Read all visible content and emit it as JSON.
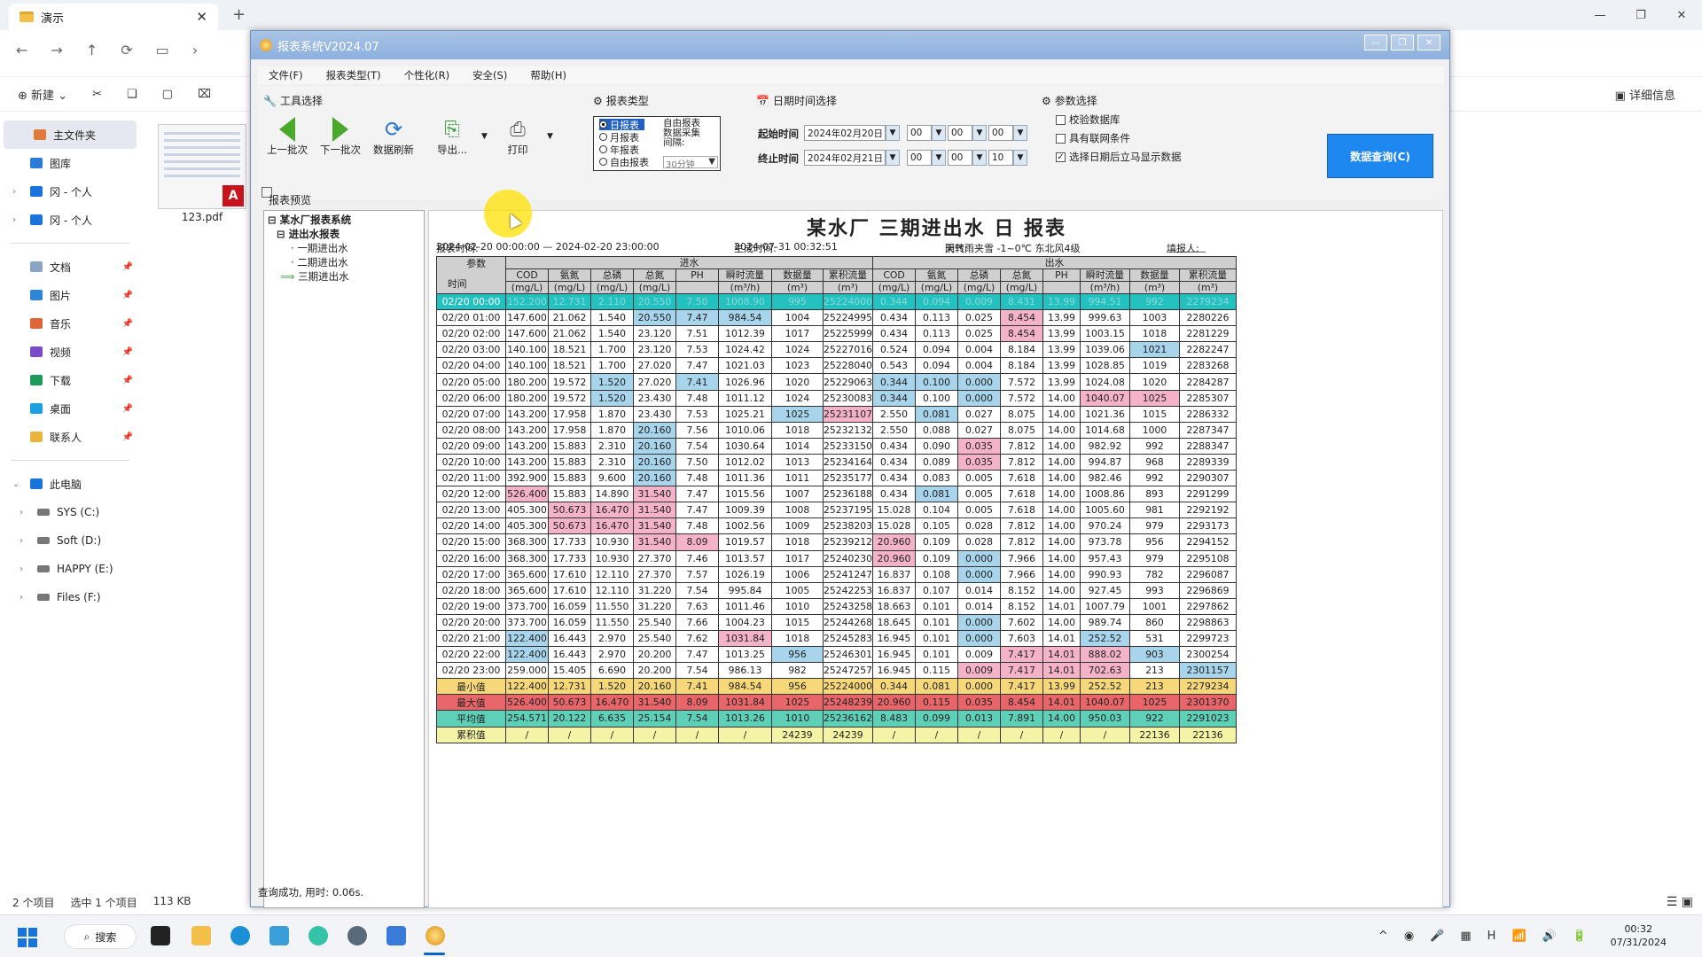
{
  "explorer": {
    "tab_title": "演示",
    "new_tab": "+",
    "nav": [
      "←",
      "→",
      "↑",
      "⟳",
      "▭",
      "›"
    ],
    "cmd": {
      "new": "新建",
      "details": "详细信息"
    },
    "sidebar": {
      "quick": [
        {
          "label": "主文件夹",
          "color": "#e07a3a"
        },
        {
          "label": "图库",
          "color": "#2b7bd6"
        },
        {
          "label": "冈 - 个人",
          "color": "#1a73d9"
        },
        {
          "label": "冈 - 个人",
          "color": "#1a73d9"
        }
      ],
      "pinned": [
        {
          "label": "文档",
          "color": "#8aa4c8"
        },
        {
          "label": "图片",
          "color": "#2d86d8"
        },
        {
          "label": "音乐",
          "color": "#e0633a"
        },
        {
          "label": "视频",
          "color": "#7a4bc8"
        },
        {
          "label": "下载",
          "color": "#1c9b5a"
        },
        {
          "label": "桌面",
          "color": "#1ba1e2"
        },
        {
          "label": "联系人",
          "color": "#e8b43a"
        }
      ],
      "pc": "此电脑",
      "drives": [
        "SYS (C:)",
        "Soft (D:)",
        "HAPPY (E:)",
        "Files (F:)"
      ]
    },
    "file": {
      "name": "123.pdf",
      "badge": "A"
    },
    "status": {
      "count": "2 个项目",
      "selected": "选中 1 个项目",
      "size": "113 KB"
    }
  },
  "app": {
    "title": "报表系统V2024.07",
    "menu": [
      "文件(F)",
      "报表类型(T)",
      "个性化(R)",
      "安全(S)",
      "帮助(H)"
    ],
    "tools": {
      "title": "工具选择",
      "prev": "上一批次",
      "next": "下一批次",
      "refresh": "数据刷新",
      "export": "导出...",
      "print": "打印"
    },
    "rtype": {
      "title": "报表类型",
      "daily": "日报表",
      "monthly": "月报表",
      "yearly": "年报表",
      "custom": "自由报表",
      "custom_right": "自由报表",
      "collect": "数据采集",
      "interval_label": "间隔:",
      "interval": "30分钟"
    },
    "dt": {
      "title": "日期时间选择",
      "start_label": "起始时间",
      "start_date": "2024年02月20日",
      "start_h": "00",
      "start_m": "00",
      "start_s": "00",
      "end_label": "终止时间",
      "end_date": "2024年02月21日",
      "end_h": "00",
      "end_m": "00",
      "end_s": "10"
    },
    "params": {
      "title": "参数选择",
      "check1": "校验数据库",
      "check2": "具有联网条件",
      "check3": "选择日期后立马显示数据"
    },
    "query": "数据查询(C)",
    "preview": "报表预览",
    "tree": {
      "root": "某水厂报表系统",
      "group": "进出水报表",
      "items": [
        "一期进出水",
        "二期进出水",
        "三期进出水"
      ]
    },
    "status": "查询成功, 用时: 0.06s."
  },
  "report": {
    "title": "某水厂 三期进出水 日 报表",
    "time_label": "报表时间:",
    "time_range": "2024-02-20 00:00:00 — 2024-02-20 23:00:00",
    "gen_label": "生成时间:",
    "gen_time": "2024-07-31  00:32:51",
    "weather_label": "天气:",
    "weather": "阴转雨夹雪  -1~0℃  东北风4级",
    "filler_label": "填报人:",
    "filler": "________",
    "header": {
      "param": "参数",
      "time": "时间",
      "in": "进水",
      "out": "出水",
      "cols_in": [
        [
          "COD",
          "(mg/L)"
        ],
        [
          "氨氮",
          "(mg/L)"
        ],
        [
          "总磷",
          "(mg/L)"
        ],
        [
          "总氮",
          "(mg/L)"
        ],
        [
          "PH",
          ""
        ],
        [
          "瞬时流量",
          "(m³/h)"
        ],
        [
          "数据量",
          "(m³)"
        ],
        [
          "累积流量",
          "(m³)"
        ]
      ],
      "cols_out": [
        [
          "COD",
          "(mg/L)"
        ],
        [
          "氨氮",
          "(mg/L)"
        ],
        [
          "总磷",
          "(mg/L)"
        ],
        [
          "总氮",
          "(mg/L)"
        ],
        [
          "PH",
          ""
        ],
        [
          "瞬时流量",
          "(m³/h)"
        ],
        [
          "数据量",
          "(m³)"
        ],
        [
          "累积流量",
          "(m³)"
        ]
      ]
    },
    "rows": [
      [
        "02/20 00:00",
        "152.200",
        "12.731",
        "2.110",
        "20.550",
        "7.50",
        "1008.90",
        "995",
        "25224000",
        "0.344",
        "0.094",
        "0.009",
        "8.431",
        "13.99",
        "994.51",
        "992",
        "2279234"
      ],
      [
        "02/20 01:00",
        "147.600",
        "21.062",
        "1.540",
        "20.550",
        "7.47",
        "984.54",
        "1004",
        "25224995",
        "0.434",
        "0.113",
        "0.025",
        "8.454",
        "13.99",
        "999.63",
        "1003",
        "2280226"
      ],
      [
        "02/20 02:00",
        "147.600",
        "21.062",
        "1.540",
        "23.120",
        "7.51",
        "1012.39",
        "1017",
        "25225999",
        "0.434",
        "0.113",
        "0.025",
        "8.454",
        "13.99",
        "1003.15",
        "1018",
        "2281229"
      ],
      [
        "02/20 03:00",
        "140.100",
        "18.521",
        "1.700",
        "23.120",
        "7.53",
        "1024.42",
        "1024",
        "25227016",
        "0.524",
        "0.094",
        "0.004",
        "8.184",
        "13.99",
        "1039.06",
        "1021",
        "2282247"
      ],
      [
        "02/20 04:00",
        "140.100",
        "18.521",
        "1.700",
        "27.020",
        "7.47",
        "1021.03",
        "1023",
        "25228040",
        "0.543",
        "0.094",
        "0.004",
        "8.184",
        "13.99",
        "1028.85",
        "1019",
        "2283268"
      ],
      [
        "02/20 05:00",
        "180.200",
        "19.572",
        "1.520",
        "27.020",
        "7.41",
        "1026.96",
        "1020",
        "25229063",
        "0.344",
        "0.100",
        "0.000",
        "7.572",
        "13.99",
        "1024.08",
        "1020",
        "2284287"
      ],
      [
        "02/20 06:00",
        "180.200",
        "19.572",
        "1.520",
        "23.430",
        "7.48",
        "1011.12",
        "1024",
        "25230083",
        "0.344",
        "0.100",
        "0.000",
        "7.572",
        "14.00",
        "1040.07",
        "1025",
        "2285307"
      ],
      [
        "02/20 07:00",
        "143.200",
        "17.958",
        "1.870",
        "23.430",
        "7.53",
        "1025.21",
        "1025",
        "25231107",
        "2.550",
        "0.081",
        "0.027",
        "8.075",
        "14.00",
        "1021.36",
        "1015",
        "2286332"
      ],
      [
        "02/20 08:00",
        "143.200",
        "17.958",
        "1.870",
        "20.160",
        "7.56",
        "1010.06",
        "1018",
        "25232132",
        "2.550",
        "0.088",
        "0.027",
        "8.075",
        "14.00",
        "1014.68",
        "1000",
        "2287347"
      ],
      [
        "02/20 09:00",
        "143.200",
        "15.883",
        "2.310",
        "20.160",
        "7.54",
        "1030.64",
        "1014",
        "25233150",
        "0.434",
        "0.090",
        "0.035",
        "7.812",
        "14.00",
        "982.92",
        "992",
        "2288347"
      ],
      [
        "02/20 10:00",
        "143.200",
        "15.883",
        "2.310",
        "20.160",
        "7.50",
        "1012.02",
        "1013",
        "25234164",
        "0.434",
        "0.089",
        "0.035",
        "7.812",
        "14.00",
        "994.87",
        "968",
        "2289339"
      ],
      [
        "02/20 11:00",
        "392.900",
        "15.883",
        "9.600",
        "20.160",
        "7.48",
        "1011.36",
        "1011",
        "25235177",
        "0.434",
        "0.083",
        "0.005",
        "7.618",
        "14.00",
        "982.46",
        "992",
        "2290307"
      ],
      [
        "02/20 12:00",
        "526.400",
        "15.883",
        "14.890",
        "31.540",
        "7.47",
        "1015.56",
        "1007",
        "25236188",
        "0.434",
        "0.081",
        "0.005",
        "7.618",
        "14.00",
        "1008.86",
        "893",
        "2291299"
      ],
      [
        "02/20 13:00",
        "405.300",
        "50.673",
        "16.470",
        "31.540",
        "7.47",
        "1009.39",
        "1008",
        "25237195",
        "15.028",
        "0.104",
        "0.005",
        "7.618",
        "14.00",
        "1005.60",
        "981",
        "2292192"
      ],
      [
        "02/20 14:00",
        "405.300",
        "50.673",
        "16.470",
        "31.540",
        "7.48",
        "1002.56",
        "1009",
        "25238203",
        "15.028",
        "0.105",
        "0.028",
        "7.812",
        "14.00",
        "970.24",
        "979",
        "2293173"
      ],
      [
        "02/20 15:00",
        "368.300",
        "17.733",
        "10.930",
        "31.540",
        "8.09",
        "1019.57",
        "1018",
        "25239212",
        "20.960",
        "0.109",
        "0.028",
        "7.812",
        "14.00",
        "973.78",
        "956",
        "2294152"
      ],
      [
        "02/20 16:00",
        "368.300",
        "17.733",
        "10.930",
        "27.370",
        "7.46",
        "1013.57",
        "1017",
        "25240230",
        "20.960",
        "0.109",
        "0.000",
        "7.966",
        "14.00",
        "957.43",
        "979",
        "2295108"
      ],
      [
        "02/20 17:00",
        "365.600",
        "17.610",
        "12.110",
        "27.370",
        "7.57",
        "1026.19",
        "1006",
        "25241247",
        "16.837",
        "0.108",
        "0.000",
        "7.966",
        "14.00",
        "990.93",
        "782",
        "2296087"
      ],
      [
        "02/20 18:00",
        "365.600",
        "17.610",
        "12.110",
        "31.220",
        "7.54",
        "995.84",
        "1005",
        "25242253",
        "16.837",
        "0.107",
        "0.014",
        "8.152",
        "14.00",
        "927.45",
        "993",
        "2296869"
      ],
      [
        "02/20 19:00",
        "373.700",
        "16.059",
        "11.550",
        "31.220",
        "7.63",
        "1011.46",
        "1010",
        "25243258",
        "18.663",
        "0.101",
        "0.014",
        "8.152",
        "14.01",
        "1007.79",
        "1001",
        "2297862"
      ],
      [
        "02/20 20:00",
        "373.700",
        "16.059",
        "11.550",
        "25.540",
        "7.66",
        "1004.23",
        "1015",
        "25244268",
        "18.645",
        "0.101",
        "0.000",
        "7.602",
        "14.00",
        "989.74",
        "860",
        "2298863"
      ],
      [
        "02/20 21:00",
        "122.400",
        "16.443",
        "2.970",
        "25.540",
        "7.62",
        "1031.84",
        "1018",
        "25245283",
        "16.945",
        "0.101",
        "0.000",
        "7.603",
        "14.01",
        "252.52",
        "531",
        "2299723"
      ],
      [
        "02/20 22:00",
        "122.400",
        "16.443",
        "2.970",
        "20.200",
        "7.47",
        "1013.25",
        "956",
        "25246301",
        "16.945",
        "0.101",
        "0.009",
        "7.417",
        "14.01",
        "888.02",
        "903",
        "2300254"
      ],
      [
        "02/20 23:00",
        "259.000",
        "15.405",
        "6.690",
        "20.200",
        "7.54",
        "986.13",
        "982",
        "25247257",
        "16.945",
        "0.115",
        "0.009",
        "7.417",
        "14.01",
        "702.63",
        "213",
        "2301157"
      ]
    ],
    "summary": [
      {
        "label": "最小值",
        "cells": [
          "122.400",
          "12.731",
          "1.520",
          "20.160",
          "7.41",
          "984.54",
          "956",
          "25224000",
          "0.344",
          "0.081",
          "0.000",
          "7.417",
          "13.99",
          "252.52",
          "213",
          "2279234"
        ]
      },
      {
        "label": "最大值",
        "cells": [
          "526.400",
          "50.673",
          "16.470",
          "31.540",
          "8.09",
          "1031.84",
          "1025",
          "25248239",
          "20.960",
          "0.115",
          "0.035",
          "8.454",
          "14.01",
          "1040.07",
          "1025",
          "2301370"
        ]
      },
      {
        "label": "平均值",
        "cells": [
          "254.571",
          "20.122",
          "6.635",
          "25.154",
          "7.54",
          "1013.26",
          "1010",
          "25236162",
          "8.483",
          "0.099",
          "0.013",
          "7.891",
          "14.00",
          "950.03",
          "922",
          "2291023"
        ]
      },
      {
        "label": "累积值",
        "cells": [
          "/",
          "/",
          "/",
          "/",
          "/",
          "/",
          "24239",
          "24239",
          "/",
          "/",
          "/",
          "/",
          "/",
          "/",
          "22136",
          "22136"
        ]
      }
    ],
    "colors": {
      "first_row": "#24c1c1",
      "min": "#f6d77a",
      "max": "#e8656a",
      "avg": "#5ed0b8",
      "total": "#f4f4a6",
      "low": "#a8d4ec",
      "high": "#f4b3c8"
    }
  },
  "taskbar": {
    "search": "搜索",
    "tray": [
      "^",
      "◉",
      "🎤",
      "▦",
      "H",
      "📶",
      "🔊",
      "🔋"
    ],
    "time": "00:32",
    "date": "07/31/2024"
  }
}
